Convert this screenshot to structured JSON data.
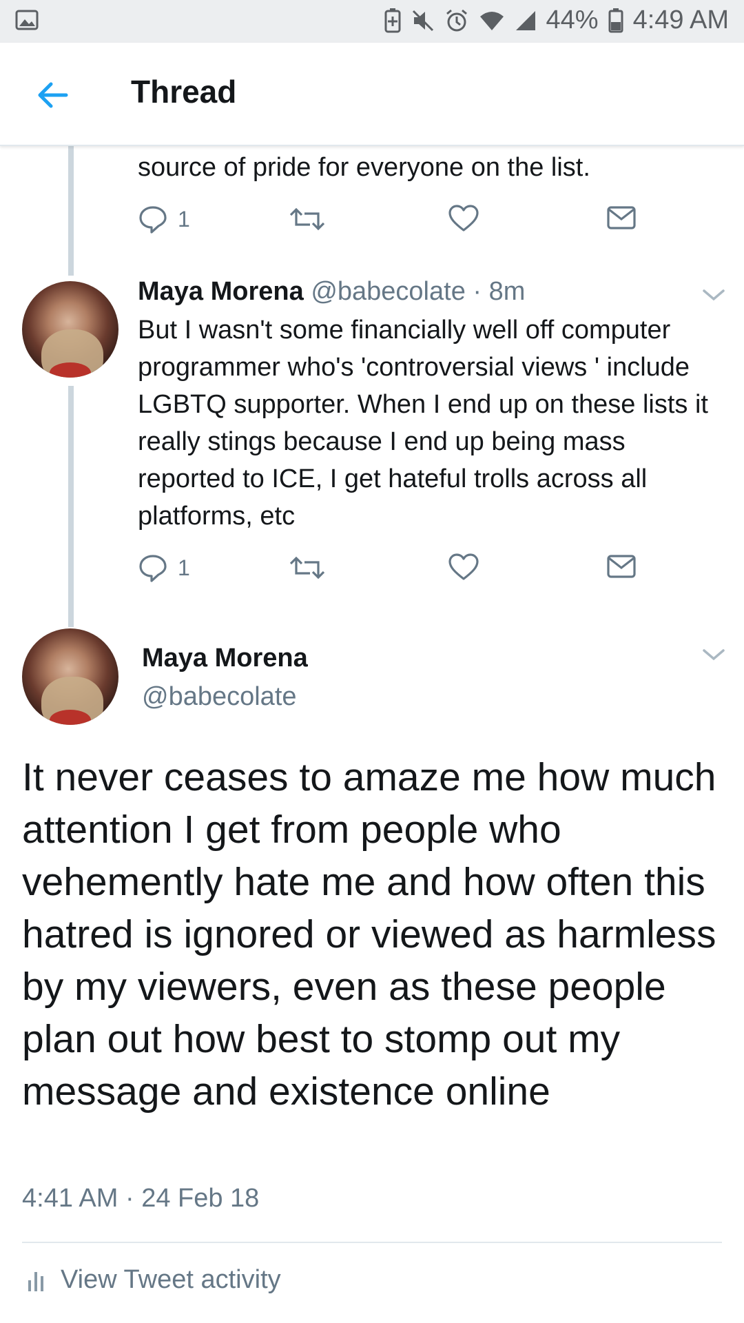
{
  "status_bar": {
    "battery": "44%",
    "time": "4:49 AM",
    "icons": [
      "image-icon",
      "battery-saver-icon",
      "mute-icon",
      "alarm-icon",
      "wifi-icon",
      "signal-icon",
      "battery-icon"
    ]
  },
  "header": {
    "title": "Thread",
    "back_icon": "arrow-left-icon"
  },
  "tweets": [
    {
      "text": "source of pride for everyone on the list.",
      "actions": {
        "reply_count": "1"
      }
    },
    {
      "name": "Maya Morena",
      "handle": "@babecolate",
      "time": "· 8m",
      "text": "But I wasn't some financially well off computer programmer who's 'controversial views ' include LGBTQ supporter. When I end up on these lists it really stings because I end up being mass reported to ICE, I get hateful trolls across all platforms, etc",
      "actions": {
        "reply_count": "1"
      }
    }
  ],
  "focused": {
    "name": "Maya Morena",
    "handle": "@babecolate",
    "text": "It never ceases to amaze me how much attention I get from people who vehemently hate me and how often this hatred is ignored or viewed as harmless by my viewers, even as these people plan out how best to stomp out my message and existence online",
    "timestamp": "4:41 AM · 24 Feb 18",
    "activity_label": "View Tweet activity"
  },
  "colors": {
    "accent": "#1da1f2",
    "muted": "#657786",
    "border": "#e1e8ed"
  }
}
